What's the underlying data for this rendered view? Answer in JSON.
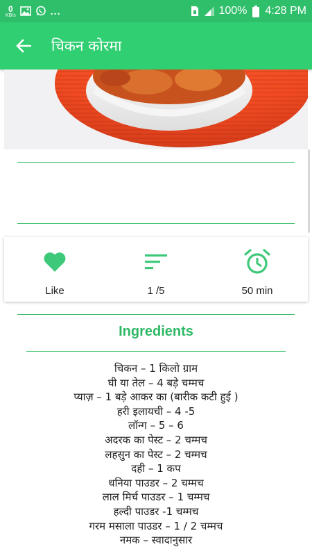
{
  "status_bar": {
    "data_speed_value": "0",
    "data_speed_unit": "KB/s",
    "more": "...",
    "battery": "100%",
    "time": "4:28 PM"
  },
  "app_bar": {
    "title": "चिकन कोरमा"
  },
  "actions": {
    "like_label": "Like",
    "servings_label": "1 /5",
    "time_label": "50 min"
  },
  "ingredients": {
    "title": "Ingredients",
    "items": [
      "चिकन – 1 किलो ग्राम",
      "घी या तेल – 4 बड़े चम्मच",
      "प्याज़ – 1 बड़े आकर का (बारीक कटी हुई )",
      "हरी इलायची – 4 -5",
      "लॉन्ग – 5 – 6",
      "अदरक का पेस्ट – 2 चम्मच",
      "लहसुन का पेस्ट – 2 चम्मच",
      "दही – 1 कप",
      "धनिया पाउडर – 2 चम्मच",
      "लाल मिर्च पाउडर – 1 चम्मच",
      "हल्दी पाउडर -1 चम्मच",
      "गरम मसाला पाउडर – 1 / 2 चम्मच",
      "नमक – स्वादानुसार"
    ]
  },
  "colors": {
    "status_bar": "#2fbf6a",
    "app_bar": "#2fcf72",
    "accent": "#2eb865",
    "icon_green": "#3ec97a"
  }
}
